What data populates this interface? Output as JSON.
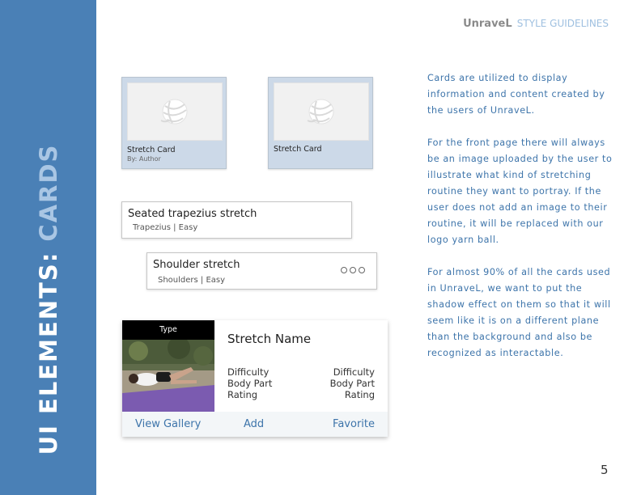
{
  "header": {
    "brand": "UnraveL",
    "subtitle": "STYLE GUIDELINES"
  },
  "sidebar": {
    "title_main": "UI ELEMENTS: ",
    "title_accent": "CARDS"
  },
  "image_cards": [
    {
      "title": "Stretch Card",
      "author": "By: Author"
    },
    {
      "title": "Stretch Card"
    }
  ],
  "list_cards": [
    {
      "title": "Seated trapezius stretch",
      "subtitle": "Trapezius |  Easy"
    },
    {
      "title": "Shoulder stretch",
      "subtitle": "Shoulders |  Easy"
    }
  ],
  "detail_card": {
    "type_label": "Type",
    "name": "Stretch Name",
    "attributes": [
      "Difficulty",
      "Body Part",
      "Rating"
    ],
    "actions": {
      "gallery": "View Gallery",
      "add": "Add",
      "favorite": "Favorite"
    }
  },
  "body_text": [
    "Cards are utilized to display information and content created by the users of UnraveL.",
    "For the front page there will always be an image uploaded by the user to illustrate what kind of stretching routine they want to portray.  If the user does not add an image to their routine, it will be replaced with our logo yarn ball.",
    "For almost 90% of all the cards used in UnraveL, we want to put the shadow effect on them so that it will seem like it is on a different plane than the background and also be recognized as interactable."
  ],
  "page_number": "5",
  "colors": {
    "sidebar": "#4a80b6",
    "accent": "#a9c6e4",
    "text_blue": "#3d74aa",
    "card_bg": "#ccd9e8"
  }
}
